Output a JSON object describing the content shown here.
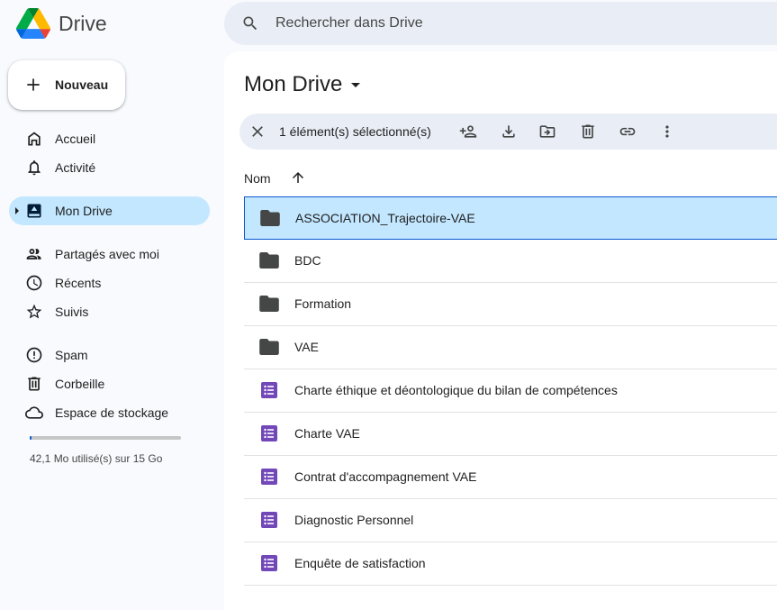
{
  "app": {
    "name": "Drive"
  },
  "search": {
    "placeholder": "Rechercher dans Drive"
  },
  "new_button": {
    "label": "Nouveau"
  },
  "sidebar": {
    "items": [
      {
        "label": "Accueil",
        "icon": "home-icon"
      },
      {
        "label": "Activité",
        "icon": "bell-icon"
      },
      {
        "label": "Mon Drive",
        "icon": "my-drive-icon",
        "active": true
      },
      {
        "label": "Partagés avec moi",
        "icon": "people-icon"
      },
      {
        "label": "Récents",
        "icon": "clock-icon"
      },
      {
        "label": "Suivis",
        "icon": "star-icon"
      },
      {
        "label": "Spam",
        "icon": "spam-icon"
      },
      {
        "label": "Corbeille",
        "icon": "trash-icon"
      },
      {
        "label": "Espace de stockage",
        "icon": "cloud-icon"
      }
    ]
  },
  "storage": {
    "text": "42,1 Mo utilisé(s) sur 15 Go",
    "used_fraction": 0.003
  },
  "main": {
    "title": "Mon Drive",
    "selection": {
      "text": "1 élément(s) sélectionné(s)"
    },
    "column_header": "Nom",
    "files": [
      {
        "name": "ASSOCIATION_Trajectoire-VAE",
        "type": "folder",
        "selected": true
      },
      {
        "name": "BDC",
        "type": "folder"
      },
      {
        "name": "Formation",
        "type": "folder"
      },
      {
        "name": "VAE",
        "type": "folder"
      },
      {
        "name": "Charte éthique et déontologique du bilan de compétences",
        "type": "form"
      },
      {
        "name": "Charte VAE",
        "type": "form"
      },
      {
        "name": "Contrat d'accompagnement VAE",
        "type": "form"
      },
      {
        "name": "Diagnostic Personnel",
        "type": "form"
      },
      {
        "name": "Enquête de satisfaction",
        "type": "form"
      }
    ]
  },
  "colors": {
    "accent": "#0b57d0",
    "selected_bg": "#c2e7ff",
    "form_purple": "#7248b9",
    "folder_gray": "#444746"
  }
}
